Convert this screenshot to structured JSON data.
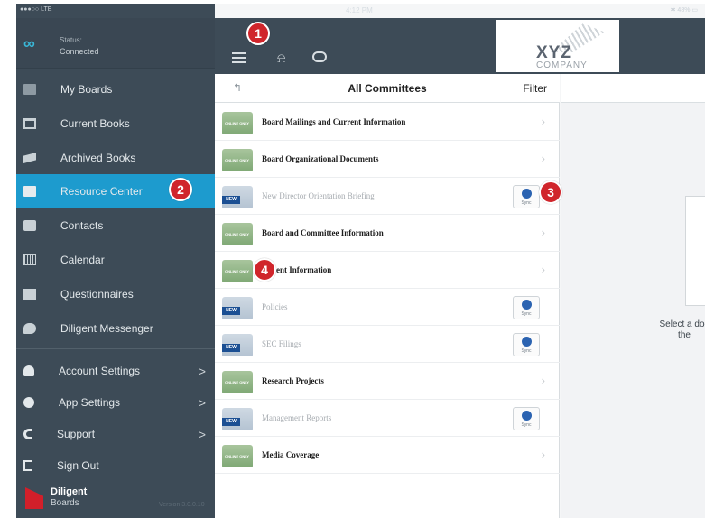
{
  "status_bar": {
    "carrier": "●●●○○ LTE",
    "time": "4:12 PM",
    "battery": "✱ 48% ▭"
  },
  "sidebar": {
    "status_label": "Status:",
    "status_value": "Connected",
    "items": [
      {
        "label": "My Boards",
        "icon": "boards-icon"
      },
      {
        "label": "Current Books",
        "icon": "book-icon"
      },
      {
        "label": "Archived Books",
        "icon": "archive-icon"
      },
      {
        "label": "Resource Center",
        "icon": "folder-icon",
        "active": true
      },
      {
        "label": "Contacts",
        "icon": "contacts-icon"
      },
      {
        "label": "Calendar",
        "icon": "calendar-icon"
      },
      {
        "label": "Questionnaires",
        "icon": "questionnaire-icon"
      },
      {
        "label": "Diligent Messenger",
        "icon": "messenger-icon"
      }
    ],
    "settings": [
      {
        "label": "Account Settings",
        "chevron": ">"
      },
      {
        "label": "App Settings",
        "chevron": ">"
      },
      {
        "label": "Support",
        "chevron": ">"
      },
      {
        "label": "Sign Out",
        "chevron": ""
      }
    ],
    "brand_line1": "Diligent",
    "brand_line2": "Boards",
    "version": "Version 3.0.0.10"
  },
  "toolbar": {
    "logo_main": "XYZ",
    "logo_sub": "COMPANY"
  },
  "panel": {
    "back": "↰",
    "title": "All Committees",
    "filter": "Filter",
    "rows": [
      {
        "label": "Board Mailings and Current Information",
        "folder": "green",
        "tag": "ONLINE ONLY"
      },
      {
        "label": "Board Organizational Documents",
        "folder": "green",
        "tag": "ONLINE ONLY"
      },
      {
        "label": "New Director Orientation Briefing",
        "folder": "blue",
        "tag": "NEW",
        "sync": "Sync"
      },
      {
        "label": "Board and Committee Information",
        "folder": "green",
        "tag": "ONLINE ONLY"
      },
      {
        "label": "gement Information",
        "folder": "green",
        "tag": "ONLINE ONLY"
      },
      {
        "label": "Policies",
        "folder": "blue",
        "tag": "NEW",
        "sync": "Sync"
      },
      {
        "label": "SEC Filings",
        "folder": "blue",
        "tag": "NEW",
        "sync": "Sync"
      },
      {
        "label": "Research Projects",
        "folder": "green",
        "tag": "ONLINE ONLY"
      },
      {
        "label": "Management Reports",
        "folder": "blue",
        "tag": "NEW",
        "sync": "Sync"
      },
      {
        "label": "Media Coverage",
        "folder": "green",
        "tag": "ONLINE ONLY"
      }
    ]
  },
  "detail": {
    "message_line1": "Select a doc",
    "message_line2": "the"
  },
  "badges": [
    "1",
    "2",
    "3",
    "4"
  ],
  "colors": {
    "sidebar_bg": "#3d4b57",
    "active_bg": "#1d9bce",
    "badge": "#d0252b",
    "sync_icon": "#2b63b1"
  }
}
